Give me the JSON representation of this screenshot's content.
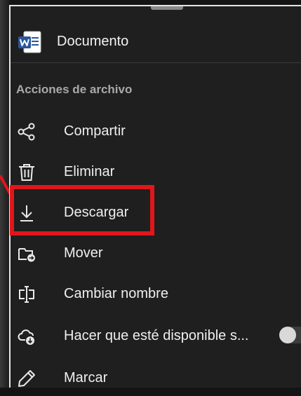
{
  "document": {
    "title": "Documento"
  },
  "section": {
    "label": "Acciones de archivo"
  },
  "actions": [
    {
      "label": "Compartir",
      "icon": "share-icon"
    },
    {
      "label": "Eliminar",
      "icon": "trash-icon"
    },
    {
      "label": "Descargar",
      "icon": "download-icon"
    },
    {
      "label": "Mover",
      "icon": "move-folder-icon"
    },
    {
      "label": "Cambiar nombre",
      "icon": "rename-icon"
    },
    {
      "label": "Hacer que esté disponible s...",
      "icon": "cloud-download-icon",
      "toggle": false
    },
    {
      "label": "Marcar",
      "icon": "pen-icon"
    }
  ],
  "colors": {
    "highlight": "#e0161b",
    "word_blue": "#2b579a"
  }
}
